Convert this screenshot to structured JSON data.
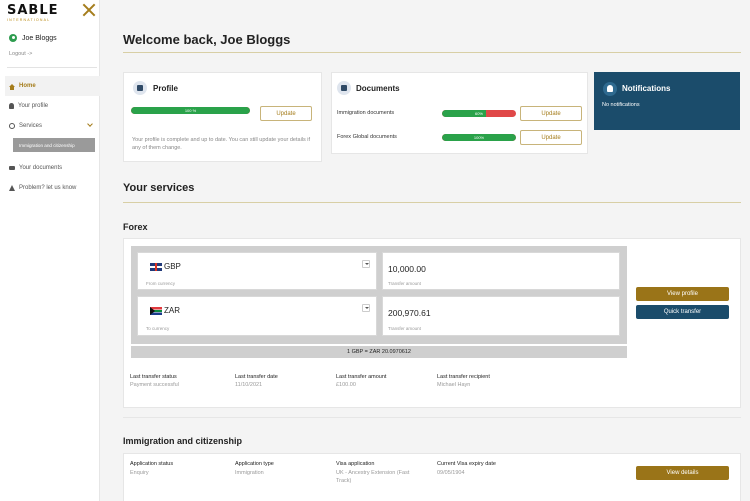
{
  "brand": {
    "name": "SABLE",
    "sub": "INTERNATIONAL"
  },
  "sidebar": {
    "user_name": "Joe Bloggs",
    "logout": "Logout ->",
    "items": [
      {
        "label": "Home"
      },
      {
        "label": "Your profile"
      },
      {
        "label": "Services"
      },
      {
        "label": "Immigration and citizenship"
      },
      {
        "label": "Your documents"
      },
      {
        "label": "Problem? let us know"
      }
    ]
  },
  "header": {
    "welcome": "Welcome back, Joe Bloggs"
  },
  "profile": {
    "title": "Profile",
    "progress": 1.0,
    "progress_label": "100 %",
    "update_label": "Update",
    "message": "Your profile is complete and up to date. You can still update your details if any of them change."
  },
  "documents": {
    "title": "Documents",
    "rows": [
      {
        "label": "Immigration documents",
        "progress": 0.6,
        "progress_label": "60%",
        "button": "Update"
      },
      {
        "label": "Forex Global documents",
        "progress": 1.0,
        "progress_label": "100%",
        "button": "Update"
      }
    ]
  },
  "notifications": {
    "title": "Notifications",
    "message": "No notifications"
  },
  "services": {
    "title": "Your services",
    "forex": {
      "title": "Forex",
      "from_currency": "GBP",
      "from_label": "From currency",
      "from_amount": "10,000.00",
      "from_amount_label": "Transfer amount",
      "to_currency": "ZAR",
      "to_label": "To currency",
      "to_amount": "200,970.61",
      "to_amount_label": "Transfer amount",
      "rate": "1 GBP = ZAR 20.0970612",
      "view_profile": "View profile",
      "quick_transfer": "Quick transfer",
      "stats": [
        {
          "label": "Last transfer status",
          "value": "Payment successful"
        },
        {
          "label": "Last transfer date",
          "value": "11/10/2021"
        },
        {
          "label": "Last transfer amount",
          "value": "£100.00"
        },
        {
          "label": "Last transfer recipient",
          "value": "Michael Hayn"
        }
      ]
    },
    "immigration": {
      "title": "Immigration and citizenship",
      "view_details": "View details",
      "stats": [
        {
          "label": "Application status",
          "value": "Enquiry"
        },
        {
          "label": "Application type",
          "value": "Immigration"
        },
        {
          "label": "Visa application",
          "value": "UK - Ancestry Extension (Fast Track)"
        },
        {
          "label": "Current Visa expiry date",
          "value": "09/05/1904"
        }
      ]
    }
  },
  "colors": {
    "gold": "#9a7418",
    "navy": "#1b4c6b",
    "green": "#2aa24a",
    "red": "#e04848"
  }
}
